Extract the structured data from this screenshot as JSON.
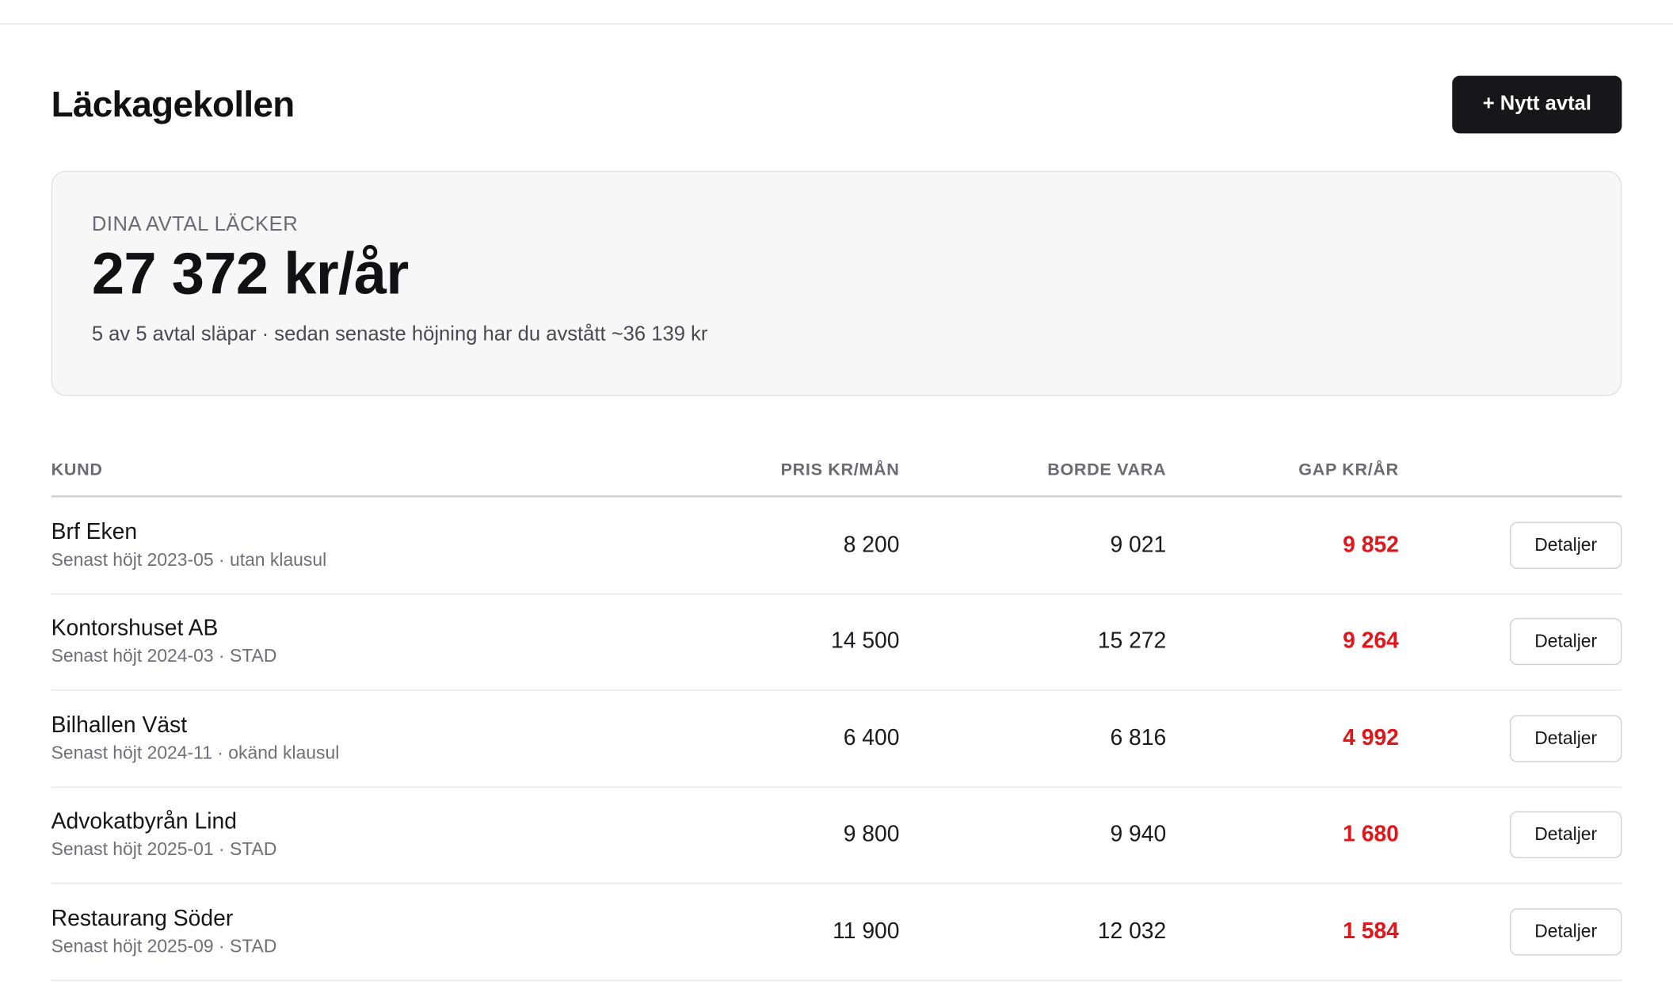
{
  "header": {
    "title": "Läckagekollen",
    "new_button": "+ Nytt avtal"
  },
  "summary": {
    "label": "DINA AVTAL LÄCKER",
    "amount": "27 372 kr/år",
    "subtext": "5 av 5 avtal släpar · sedan senaste höjning har du avstått ~36 139 kr"
  },
  "table": {
    "columns": {
      "customer": "KUND",
      "price": "PRIS KR/MÅN",
      "should_be": "BORDE VARA",
      "gap": "GAP KR/ÅR"
    },
    "rows": [
      {
        "name": "Brf Eken",
        "meta": "Senast höjt 2023-05 · utan klausul",
        "price": "8 200",
        "should_be": "9 021",
        "gap": "9 852",
        "action": "Detaljer"
      },
      {
        "name": "Kontorshuset AB",
        "meta": "Senast höjt 2024-03 · STAD",
        "price": "14 500",
        "should_be": "15 272",
        "gap": "9 264",
        "action": "Detaljer"
      },
      {
        "name": "Bilhallen Väst",
        "meta": "Senast höjt 2024-11 · okänd klausul",
        "price": "6 400",
        "should_be": "6 816",
        "gap": "4 992",
        "action": "Detaljer"
      },
      {
        "name": "Advokatbyrån Lind",
        "meta": "Senast höjt 2025-01 · STAD",
        "price": "9 800",
        "should_be": "9 940",
        "gap": "1 680",
        "action": "Detaljer"
      },
      {
        "name": "Restaurang Söder",
        "meta": "Senast höjt 2025-09 · STAD",
        "price": "11 900",
        "should_be": "12 032",
        "gap": "1 584",
        "action": "Detaljer"
      }
    ]
  },
  "colors": {
    "primary_button": "#17171a",
    "gap_red": "#e0161b",
    "card_bg": "#f7f7f8"
  }
}
